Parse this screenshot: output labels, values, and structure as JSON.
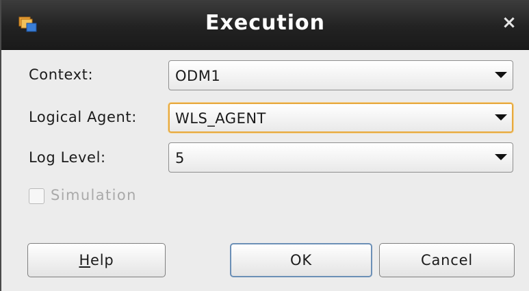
{
  "window": {
    "title": "Execution",
    "close_glyph": "×",
    "app_icon": "oracle-odi-app-icon"
  },
  "form": {
    "context": {
      "label": "Context:",
      "value": "ODM1"
    },
    "logical_agent": {
      "label": "Logical Agent:",
      "value": "WLS_AGENT"
    },
    "log_level": {
      "label": "Log Level:",
      "value": "5"
    },
    "simulation": {
      "label": "Simulation",
      "checked": false,
      "enabled": false
    }
  },
  "buttons": {
    "help_mnemonic": "H",
    "help_rest": "elp",
    "ok": "OK",
    "cancel": "Cancel"
  },
  "colors": {
    "titlebar": "#222222",
    "focus_border": "#e7a93e",
    "default_button_border": "#6b8fb6"
  }
}
